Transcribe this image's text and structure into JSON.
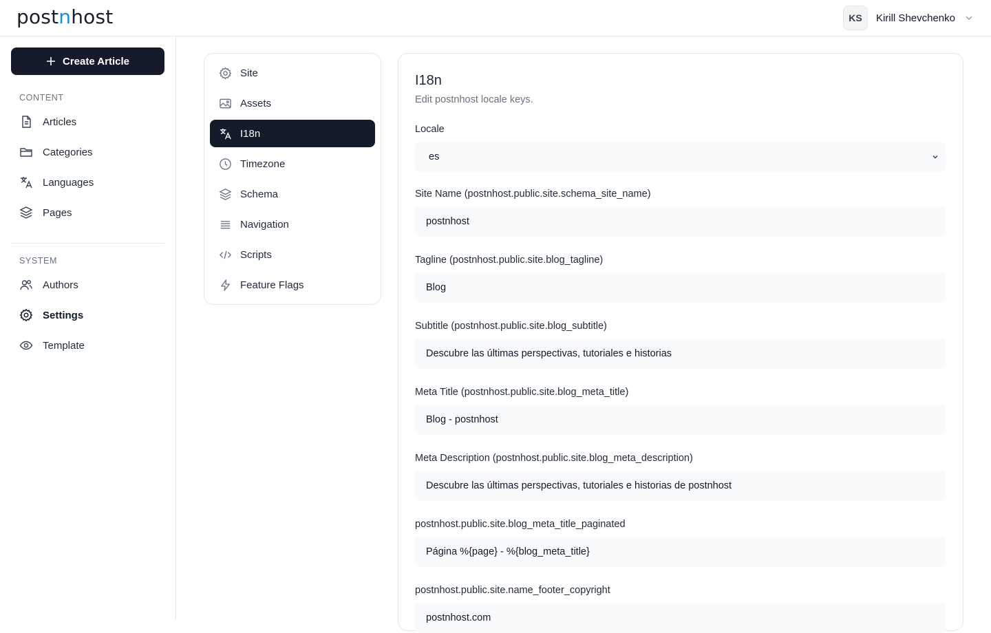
{
  "header": {
    "logo_pre": "post",
    "logo_accent": "n",
    "logo_post": "host",
    "user_initials": "KS",
    "user_name": "Kirill Shevchenko"
  },
  "sidebar": {
    "create_label": "Create Article",
    "content_label": "CONTENT",
    "system_label": "SYSTEM",
    "content_items": [
      {
        "label": "Articles",
        "icon": "file-icon"
      },
      {
        "label": "Categories",
        "icon": "folder-icon"
      },
      {
        "label": "Languages",
        "icon": "translate-icon"
      },
      {
        "label": "Pages",
        "icon": "layers-icon"
      }
    ],
    "system_items": [
      {
        "label": "Authors",
        "icon": "users-icon"
      },
      {
        "label": "Settings",
        "icon": "gear-icon",
        "active": true
      },
      {
        "label": "Template",
        "icon": "eye-icon"
      }
    ]
  },
  "settings_menu": {
    "items": [
      {
        "label": "Site",
        "icon": "gear-icon"
      },
      {
        "label": "Assets",
        "icon": "image-icon"
      },
      {
        "label": "I18n",
        "icon": "translate-icon",
        "active": true
      },
      {
        "label": "Timezone",
        "icon": "clock-icon"
      },
      {
        "label": "Schema",
        "icon": "layers-icon"
      },
      {
        "label": "Navigation",
        "icon": "menu-lines-icon"
      },
      {
        "label": "Scripts",
        "icon": "code-icon"
      },
      {
        "label": "Feature Flags",
        "icon": "bolt-icon"
      }
    ]
  },
  "form": {
    "title": "I18n",
    "subtitle": "Edit postnhost locale keys.",
    "locale_label": "Locale",
    "locale_value": "es",
    "fields": [
      {
        "label": "Site Name (postnhost.public.site.schema_site_name)",
        "value": "postnhost"
      },
      {
        "label": "Tagline (postnhost.public.site.blog_tagline)",
        "value": "Blog"
      },
      {
        "label": "Subtitle (postnhost.public.site.blog_subtitle)",
        "value": "Descubre las últimas perspectivas, tutoriales e historias"
      },
      {
        "label": "Meta Title (postnhost.public.site.blog_meta_title)",
        "value": "Blog - postnhost"
      },
      {
        "label": "Meta Description (postnhost.public.site.blog_meta_description)",
        "value": "Descubre las últimas perspectivas, tutoriales e historias de postnhost"
      },
      {
        "label": "postnhost.public.site.blog_meta_title_paginated",
        "value": "Página %{page} - %{blog_meta_title}"
      },
      {
        "label": "postnhost.public.site.name_footer_copyright",
        "value": "postnhost.com"
      }
    ]
  },
  "colors": {
    "primary_dark": "#161b2b",
    "logo_accent": "#1d8fd6",
    "border": "#e5e7eb",
    "input_bg": "#f9fafb"
  }
}
